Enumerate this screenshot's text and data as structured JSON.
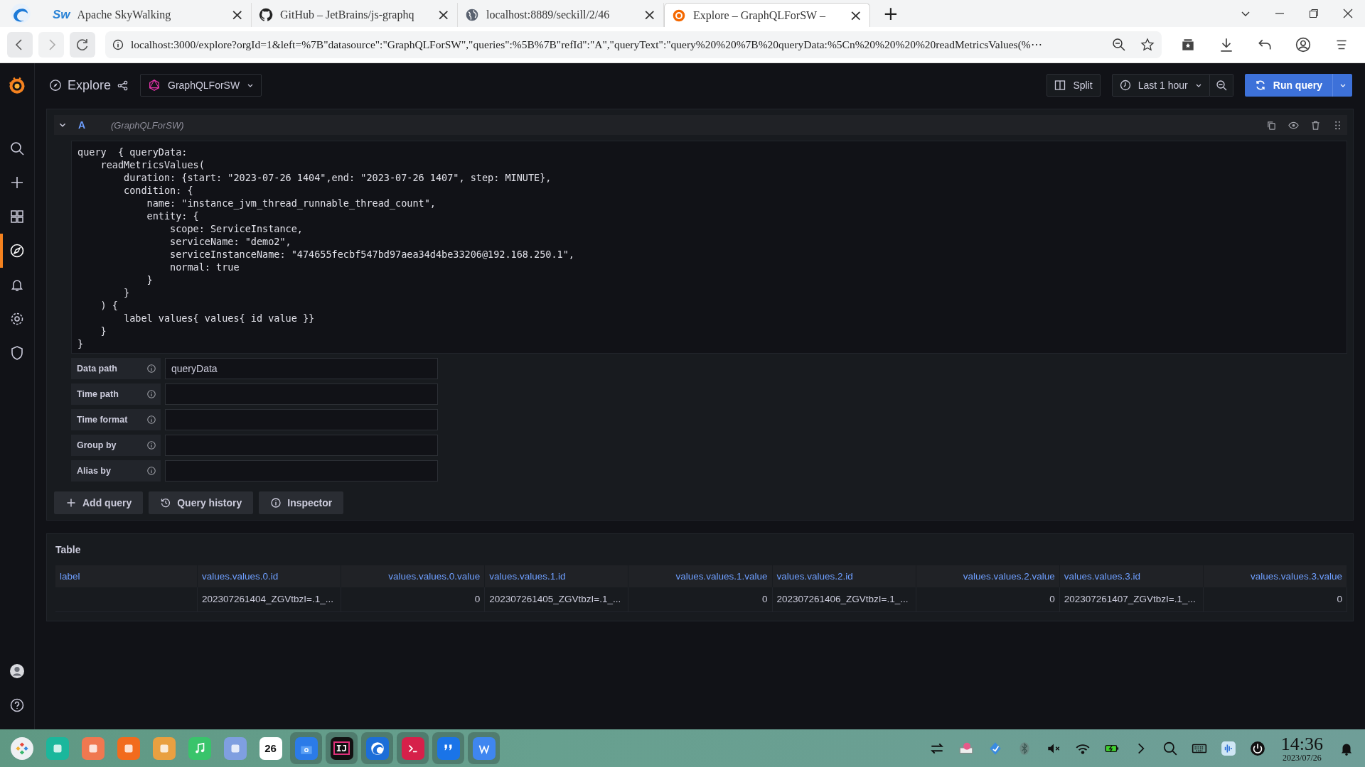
{
  "browser": {
    "tabs": [
      {
        "title": "Apache  SkyWalking",
        "icon_text": "Sw",
        "close": "×",
        "selected": false
      },
      {
        "title": "GitHub  –  JetBrains/js-graphq",
        "close": "×",
        "selected": false
      },
      {
        "title": "localhost:8889/seckill/2/46",
        "close": "×",
        "selected": false
      },
      {
        "title": "Explore  –  GraphQLForSW  –",
        "close": "×",
        "selected": true
      }
    ],
    "new_tab": "+",
    "url": "localhost:3000/explore?orgId=1&left=%7B\"datasource\":\"GraphQLForSW\",\"queries\":%5B%7B\"refId\":\"A\",\"queryText\":\"query%20%20%7B%20queryData:%5Cn%20%20%20%20readMetricsValues(%⋯"
  },
  "nav": {
    "items": [
      {
        "kind": "search",
        "selected": false
      },
      {
        "kind": "plus",
        "selected": false
      },
      {
        "kind": "dashboards",
        "selected": false
      },
      {
        "kind": "explore",
        "selected": true
      },
      {
        "kind": "alerting",
        "selected": false
      },
      {
        "kind": "settings",
        "selected": false
      },
      {
        "kind": "shield",
        "selected": false
      }
    ],
    "bottom": [
      {
        "kind": "avatar"
      },
      {
        "kind": "help"
      }
    ]
  },
  "header": {
    "title": "Explore",
    "datasource": "GraphQLForSW",
    "split": "Split",
    "time_range": "Last 1 hour",
    "run": "Run query"
  },
  "query": {
    "ref": "A",
    "datasource": "(GraphQLForSW)",
    "code": [
      "query  { queryData:",
      "    readMetricsValues(",
      "        duration: {start: \"2023-07-26 1404\",end: \"2023-07-26 1407\", step: MINUTE},",
      "        condition: {",
      "            name: \"instance_jvm_thread_runnable_thread_count\",",
      "            entity: {",
      "                scope: ServiceInstance,",
      "                serviceName: \"demo2\",",
      "                serviceInstanceName: \"474655fecbf547bd97aea34d4be33206@192.168.250.1\",",
      "                normal: true",
      "            }",
      "        }",
      "    ) {",
      "        label values{ values{ id value }}",
      "    }",
      "}"
    ],
    "fields": [
      {
        "label": "Data path",
        "value": "queryData"
      },
      {
        "label": "Time path"
      },
      {
        "label": "Time format"
      },
      {
        "label": "Group by"
      },
      {
        "label": "Alias by"
      }
    ],
    "actions": [
      {
        "kind": "add",
        "label": "Add query"
      },
      {
        "kind": "history",
        "label": "Query history"
      },
      {
        "kind": "info",
        "label": "Inspector"
      }
    ]
  },
  "table": {
    "title": "Table",
    "columns": [
      "label",
      "values.values.0.id",
      "values.values.0.value",
      "values.values.1.id",
      "values.values.1.value",
      "values.values.2.id",
      "values.values.2.value",
      "values.values.3.id",
      "values.values.3.value"
    ],
    "rows": [
      [
        "",
        "202307261404_ZGVtbzI=.1_...",
        "0",
        "202307261405_ZGVtbzI=.1_...",
        "0",
        "202307261406_ZGVtbzI=.1_...",
        "0",
        "202307261407_ZGVtbzI=.1_...",
        "0"
      ]
    ]
  },
  "taskbar": {
    "apps": [
      {
        "kind": "launcher",
        "open": false
      },
      {
        "kind": "terminal-list",
        "open": false
      },
      {
        "kind": "grid",
        "open": false
      },
      {
        "kind": "store",
        "open": false
      },
      {
        "kind": "photos",
        "open": false
      },
      {
        "kind": "music",
        "open": false
      },
      {
        "kind": "contacts",
        "open": false
      },
      {
        "kind": "calendar",
        "text": "26",
        "open": false
      },
      {
        "kind": "files",
        "open": true
      },
      {
        "kind": "ide",
        "text": "IJ",
        "open": true
      },
      {
        "kind": "browser",
        "open": true
      },
      {
        "kind": "console",
        "open": true
      },
      {
        "kind": "quote",
        "open": true
      },
      {
        "kind": "writer",
        "open": true
      }
    ],
    "tray": [
      {
        "kind": "transfer"
      },
      {
        "kind": "keyboard-color"
      },
      {
        "kind": "feather"
      },
      {
        "kind": "bluetooth"
      },
      {
        "kind": "mute"
      },
      {
        "kind": "wifi"
      },
      {
        "kind": "battery"
      },
      {
        "kind": "chevron"
      },
      {
        "kind": "search"
      },
      {
        "kind": "keyboard"
      },
      {
        "kind": "voice"
      },
      {
        "kind": "power"
      }
    ],
    "time": "14:36",
    "date": "2023/07/26"
  }
}
